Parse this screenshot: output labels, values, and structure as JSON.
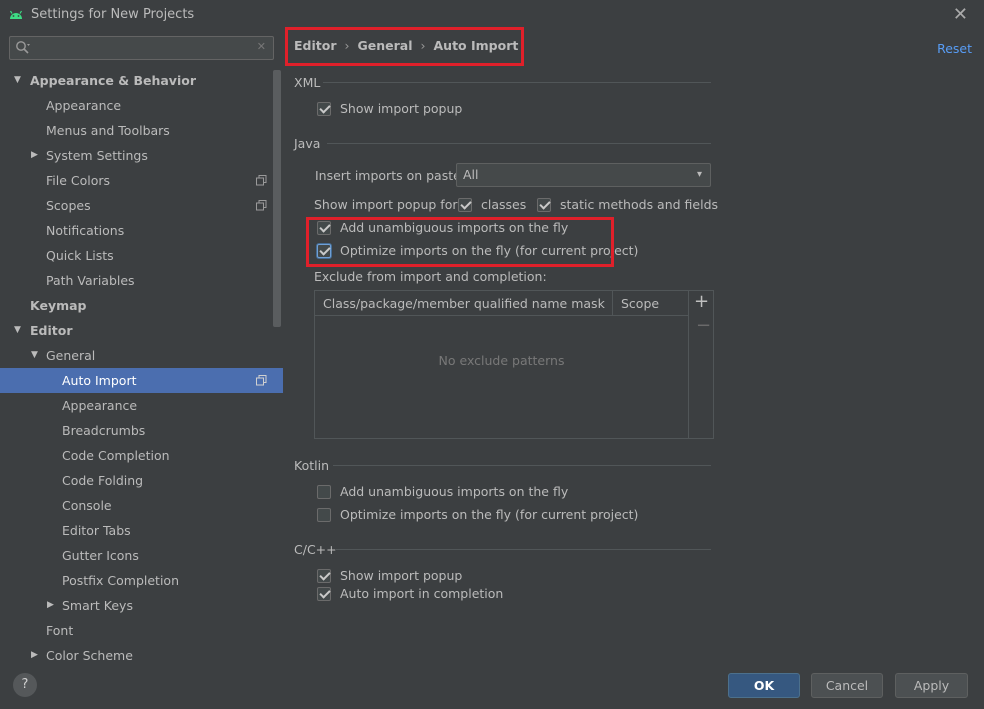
{
  "window": {
    "title": "Settings for New Projects",
    "close_glyph": "✕"
  },
  "search": {
    "value": "",
    "placeholder": "",
    "clear_glyph": "✕"
  },
  "sidebar": {
    "items": [
      {
        "label": "Appearance & Behavior"
      },
      {
        "label": "Appearance"
      },
      {
        "label": "Menus and Toolbars"
      },
      {
        "label": "System Settings"
      },
      {
        "label": "File Colors"
      },
      {
        "label": "Scopes"
      },
      {
        "label": "Notifications"
      },
      {
        "label": "Quick Lists"
      },
      {
        "label": "Path Variables"
      },
      {
        "label": "Keymap"
      },
      {
        "label": "Editor"
      },
      {
        "label": "General"
      },
      {
        "label": "Auto Import"
      },
      {
        "label": "Appearance"
      },
      {
        "label": "Breadcrumbs"
      },
      {
        "label": "Code Completion"
      },
      {
        "label": "Code Folding"
      },
      {
        "label": "Console"
      },
      {
        "label": "Editor Tabs"
      },
      {
        "label": "Gutter Icons"
      },
      {
        "label": "Postfix Completion"
      },
      {
        "label": "Smart Keys"
      },
      {
        "label": "Font"
      },
      {
        "label": "Color Scheme"
      }
    ]
  },
  "breadcrumb": {
    "items": [
      "Editor",
      "General",
      "Auto Import"
    ],
    "separator": "›"
  },
  "reset_label": "Reset",
  "xml": {
    "title": "XML",
    "show_import_popup": {
      "label": "Show import popup",
      "checked": true
    }
  },
  "java": {
    "title": "Java",
    "insert_imports_label": "Insert imports on paste:",
    "insert_imports_value": "All",
    "show_popup_for_label": "Show import popup for:",
    "classes": {
      "label": "classes",
      "checked": true
    },
    "static_methods": {
      "label": "static methods and fields",
      "checked": true
    },
    "add_unambiguous": {
      "label": "Add unambiguous imports on the fly",
      "checked": true
    },
    "optimize_imports": {
      "label": "Optimize imports on the fly (for current project)",
      "checked": true
    },
    "exclude_label": "Exclude from import and completion:",
    "table": {
      "columns": [
        "Class/package/member qualified name mask",
        "Scope"
      ],
      "empty_text": "No exclude patterns",
      "add_glyph": "+",
      "remove_glyph": "−"
    }
  },
  "kotlin": {
    "title": "Kotlin",
    "add_unambiguous": {
      "label": "Add unambiguous imports on the fly",
      "checked": false
    },
    "optimize_imports": {
      "label": "Optimize imports on the fly (for current project)",
      "checked": false
    }
  },
  "cpp": {
    "title": "C/C++",
    "show_import_popup": {
      "label": "Show import popup",
      "checked": true
    },
    "auto_import_completion": {
      "label": "Auto import in completion",
      "checked": true
    }
  },
  "footer": {
    "help_glyph": "?",
    "ok_label": "OK",
    "cancel_label": "Cancel",
    "apply_label": "Apply"
  },
  "colors": {
    "background": "#3c3f41",
    "selection": "#4b6eaf",
    "link": "#589df6",
    "primary_button": "#365880",
    "highlight_box": "#e0202a"
  }
}
